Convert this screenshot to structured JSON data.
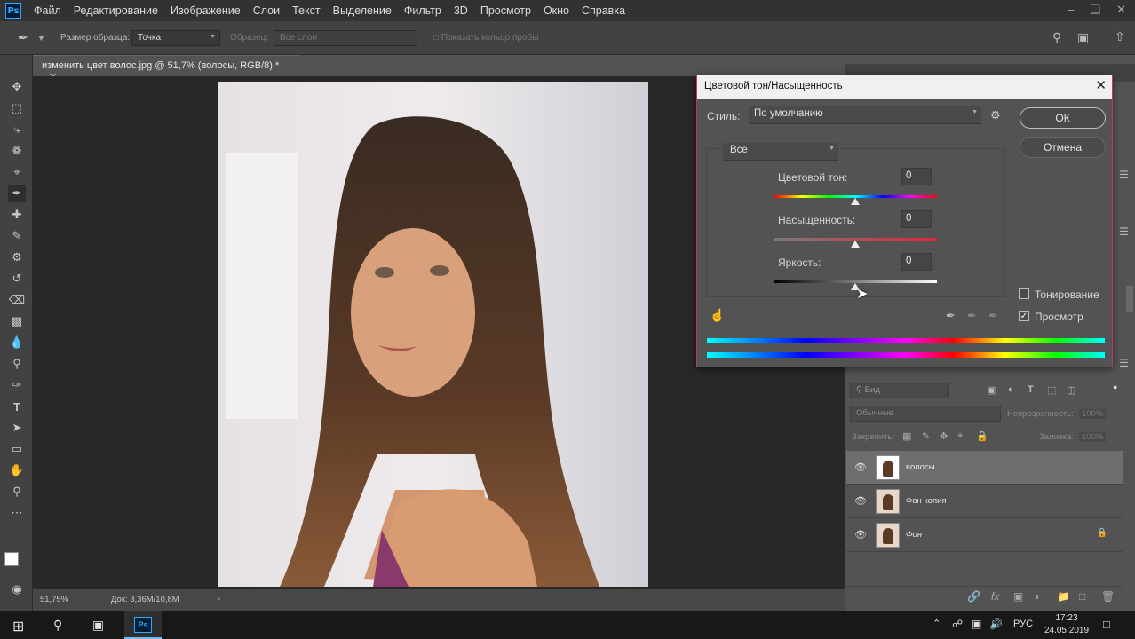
{
  "menubar": {
    "logo": "Ps",
    "items": [
      "Файл",
      "Редактирование",
      "Изображение",
      "Слои",
      "Текст",
      "Выделение",
      "Фильтр",
      "3D",
      "Просмотр",
      "Окно",
      "Справка"
    ]
  },
  "options": {
    "sample_size_label": "Размер образца:",
    "sample_size_value": "Точка",
    "sample_label": "Образец:",
    "sample_value": "Все слои",
    "show_ring": "Показать кольцо пробы"
  },
  "document": {
    "tab_title": "изменить цвет волос.jpg @ 51,7% (волосы, RGB/8) *",
    "zoom": "51,75%",
    "doc_size": "Док: 3,36M/10,8M"
  },
  "dialog": {
    "title": "Цветовой тон/Насыщенность",
    "style_label": "Стиль:",
    "style_value": "По умолчанию",
    "ok": "ОК",
    "cancel": "Отмена",
    "channel": "Все",
    "hue_label": "Цветовой тон:",
    "hue_value": "0",
    "sat_label": "Насыщенность:",
    "sat_value": "0",
    "light_label": "Яркость:",
    "light_value": "0",
    "colorize_label": "Тонирование",
    "colorize_checked": false,
    "preview_label": "Просмотр",
    "preview_checked": true
  },
  "layers": {
    "search_placeholder": "Вид",
    "blend_mode": "Обычные",
    "opacity_label": "Непрозрачность:",
    "opacity_value": "100%",
    "lock_label": "Закрепить:",
    "fill_label": "Заливка:",
    "fill_value": "100%",
    "items": [
      {
        "name": "волосы",
        "selected": true,
        "locked": false
      },
      {
        "name": "Фон копия",
        "selected": false,
        "locked": false
      },
      {
        "name": "Фон",
        "selected": false,
        "locked": true
      }
    ]
  },
  "taskbar": {
    "lang": "РУС",
    "time": "17:23",
    "date": "24.05.2019"
  },
  "colors": {
    "accent": "#31a8ff",
    "dialog_border": "#c0395a"
  }
}
